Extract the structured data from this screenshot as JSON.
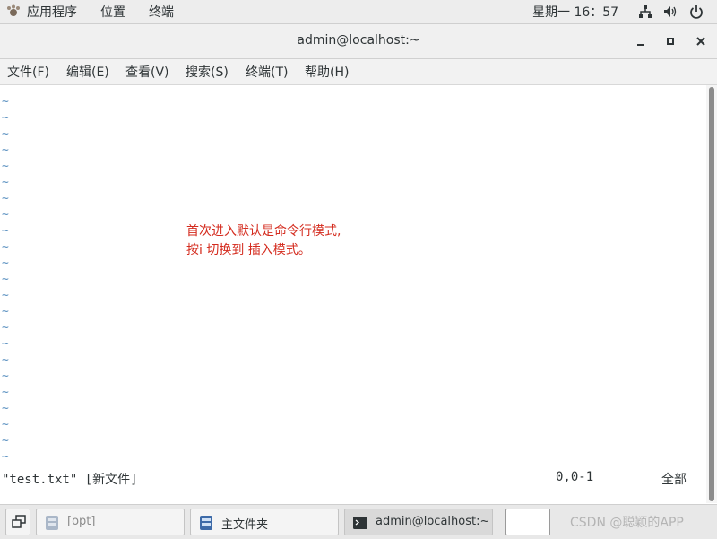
{
  "top_panel": {
    "applications": "应用程序",
    "places": "位置",
    "terminal": "终端",
    "clock": "星期一 16：57"
  },
  "window": {
    "title": "admin@localhost:~"
  },
  "menu": [
    "文件(F)",
    "编辑(E)",
    "查看(V)",
    "搜索(S)",
    "终端(T)",
    "帮助(H)"
  ],
  "terminal": {
    "tilde": "~",
    "annotation_line1": "首次进入默认是命令行模式,",
    "annotation_line2": "按i 切换到 插入模式。",
    "status_file": "\"test.txt\" [新文件]",
    "status_pos": "0,0-1",
    "status_all": "全部"
  },
  "taskbar": {
    "items": [
      "[opt]",
      "主文件夹",
      "admin@localhost:~"
    ],
    "watermark": "CSDN @聪颖的APP"
  },
  "colors": {
    "annotation": "#d42b1e",
    "tilde": "#5a90c0"
  }
}
